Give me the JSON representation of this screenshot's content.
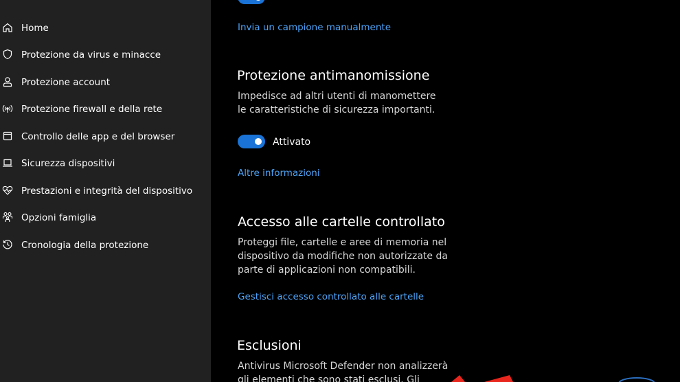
{
  "sidebar": {
    "items": [
      {
        "label": "Home",
        "icon": "home-icon"
      },
      {
        "label": "Protezione da virus e minacce",
        "icon": "shield-icon"
      },
      {
        "label": "Protezione account",
        "icon": "person-icon"
      },
      {
        "label": "Protezione firewall e della rete",
        "icon": "wifi-antenna-icon"
      },
      {
        "label": "Controllo delle app e del browser",
        "icon": "app-window-icon"
      },
      {
        "label": "Sicurezza dispositivi",
        "icon": "laptop-icon"
      },
      {
        "label": "Prestazioni e integrità del dispositivo",
        "icon": "heart-pulse-icon"
      },
      {
        "label": "Opzioni famiglia",
        "icon": "family-icon"
      },
      {
        "label": "Cronologia della protezione",
        "icon": "history-icon"
      }
    ]
  },
  "main": {
    "sample_link": "Invia un campione manualmente",
    "tamper": {
      "title": "Protezione antimanomissione",
      "description": "Impedisce ad altri utenti di manomettere le caratteristiche di sicurezza importanti.",
      "toggle_state": "Attivato",
      "toggle_on": true,
      "more_link": "Altre informazioni"
    },
    "folder_access": {
      "title": "Accesso alle cartelle controllato",
      "description": "Proteggi file, cartelle e aree di memoria nel dispositivo da modifiche non autorizzate da parte di applicazioni non compatibili.",
      "manage_link": "Gestisci accesso controllato alle cartelle"
    },
    "exclusions": {
      "title": "Esclusioni",
      "description": "Antivirus Microsoft Defender non analizzerà gli elementi che sono stati esclusi. Gli elementi"
    }
  },
  "colors": {
    "sidebar_bg": "#212121",
    "main_bg": "#000000",
    "link": "#4ca2f5",
    "toggle_on": "#1a73d6",
    "annotation_arrow": "#e8261d"
  }
}
